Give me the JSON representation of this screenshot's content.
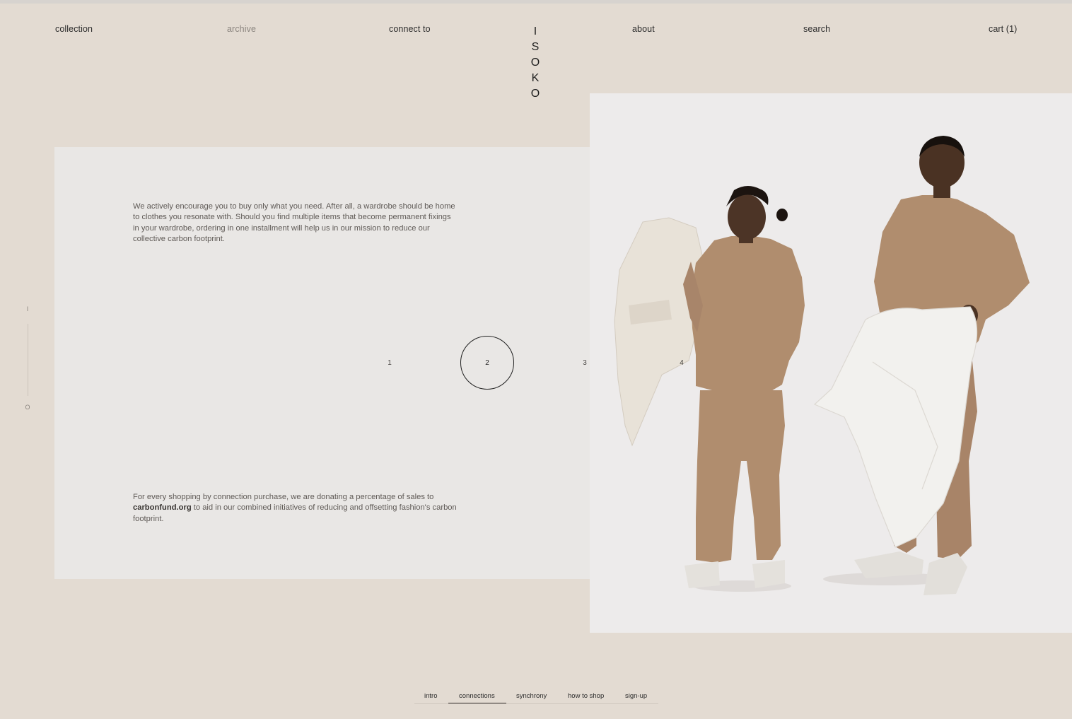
{
  "nav": {
    "collection": "collection",
    "archive": "archive",
    "connect_to": "connect to",
    "about": "about",
    "search": "search",
    "cart": "cart (1)"
  },
  "logo": {
    "letters": [
      "I",
      "S",
      "O",
      "K",
      "O"
    ]
  },
  "panel": {
    "paragraph1": "We actively encourage you to buy only what you need. After all, a wardrobe should be home to clothes you resonate with. Should you find multiple items that become permanent fixings in your wardrobe, ordering in one installment will help us in our mission to reduce our collective carbon footprint.",
    "paragraph2_before": "For every shopping by connection purchase, we are donating a percentage of sales to ",
    "paragraph2_bold": "carbonfund.org",
    "paragraph2_after": " to aid in our combined initiatives of reducing and offsetting fashion's carbon footprint.",
    "steps": [
      "1",
      "2",
      "3",
      "4"
    ],
    "active_step": "2"
  },
  "scroll_indicator": {
    "top": "I",
    "bottom": "O"
  },
  "bottom_tabs": {
    "items": [
      "intro",
      "connections",
      "synchrony",
      "how to shop",
      "sign-up"
    ],
    "active": "connections"
  },
  "colors": {
    "background": "#e3dbd2",
    "panel": "#e9e7e5",
    "garment_brown": "#b08d6e",
    "garment_cream": "#ebe6dd"
  }
}
